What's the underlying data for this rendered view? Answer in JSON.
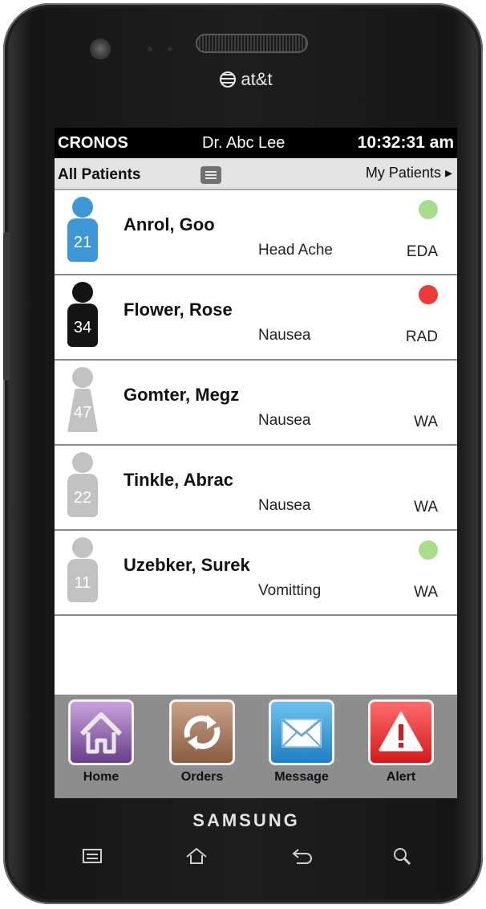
{
  "device": {
    "carrier": "at&t",
    "brand": "SAMSUNG",
    "hardware_keys": [
      "menu-key-icon",
      "home-key-icon",
      "back-key-icon",
      "search-key-icon"
    ]
  },
  "header": {
    "app_name": "CRONOS",
    "doctor": "Dr. Abc Lee",
    "time": "10:32:31 am"
  },
  "subheader": {
    "title": "All Patients",
    "my_patients": "My Patients ▸"
  },
  "patients": [
    {
      "name": "Anrol, Goo",
      "number": "21",
      "condition": "Head Ache",
      "unit": "EDA",
      "avatar_color": "#3d97d6",
      "avatar_type": "male",
      "status": "green",
      "status_color": "#a9dd8c"
    },
    {
      "name": "Flower, Rose",
      "number": "34",
      "condition": "Nausea",
      "unit": "RAD",
      "avatar_color": "#141414",
      "avatar_type": "male",
      "status": "red",
      "status_color": "#ef3a3a"
    },
    {
      "name": "Gomter, Megz",
      "number": "47",
      "condition": "Nausea",
      "unit": "WA",
      "avatar_color": "#c2c2c2",
      "avatar_type": "female",
      "status": "none",
      "status_color": ""
    },
    {
      "name": "Tinkle, Abrac",
      "number": "22",
      "condition": "Nausea",
      "unit": "WA",
      "avatar_color": "#c2c2c2",
      "avatar_type": "male",
      "status": "none",
      "status_color": ""
    },
    {
      "name": "Uzebker, Surek",
      "number": "11",
      "condition": "Vomitting",
      "unit": "WA",
      "avatar_color": "#c2c2c2",
      "avatar_type": "male",
      "status": "green",
      "status_color": "#a9dd8c"
    }
  ],
  "bottom_nav": [
    {
      "label": "Home",
      "icon": "house-icon"
    },
    {
      "label": "Orders",
      "icon": "refresh-arrows-icon"
    },
    {
      "label": "Message",
      "icon": "envelope-icon"
    },
    {
      "label": "Alert",
      "icon": "warning-triangle-icon"
    }
  ]
}
